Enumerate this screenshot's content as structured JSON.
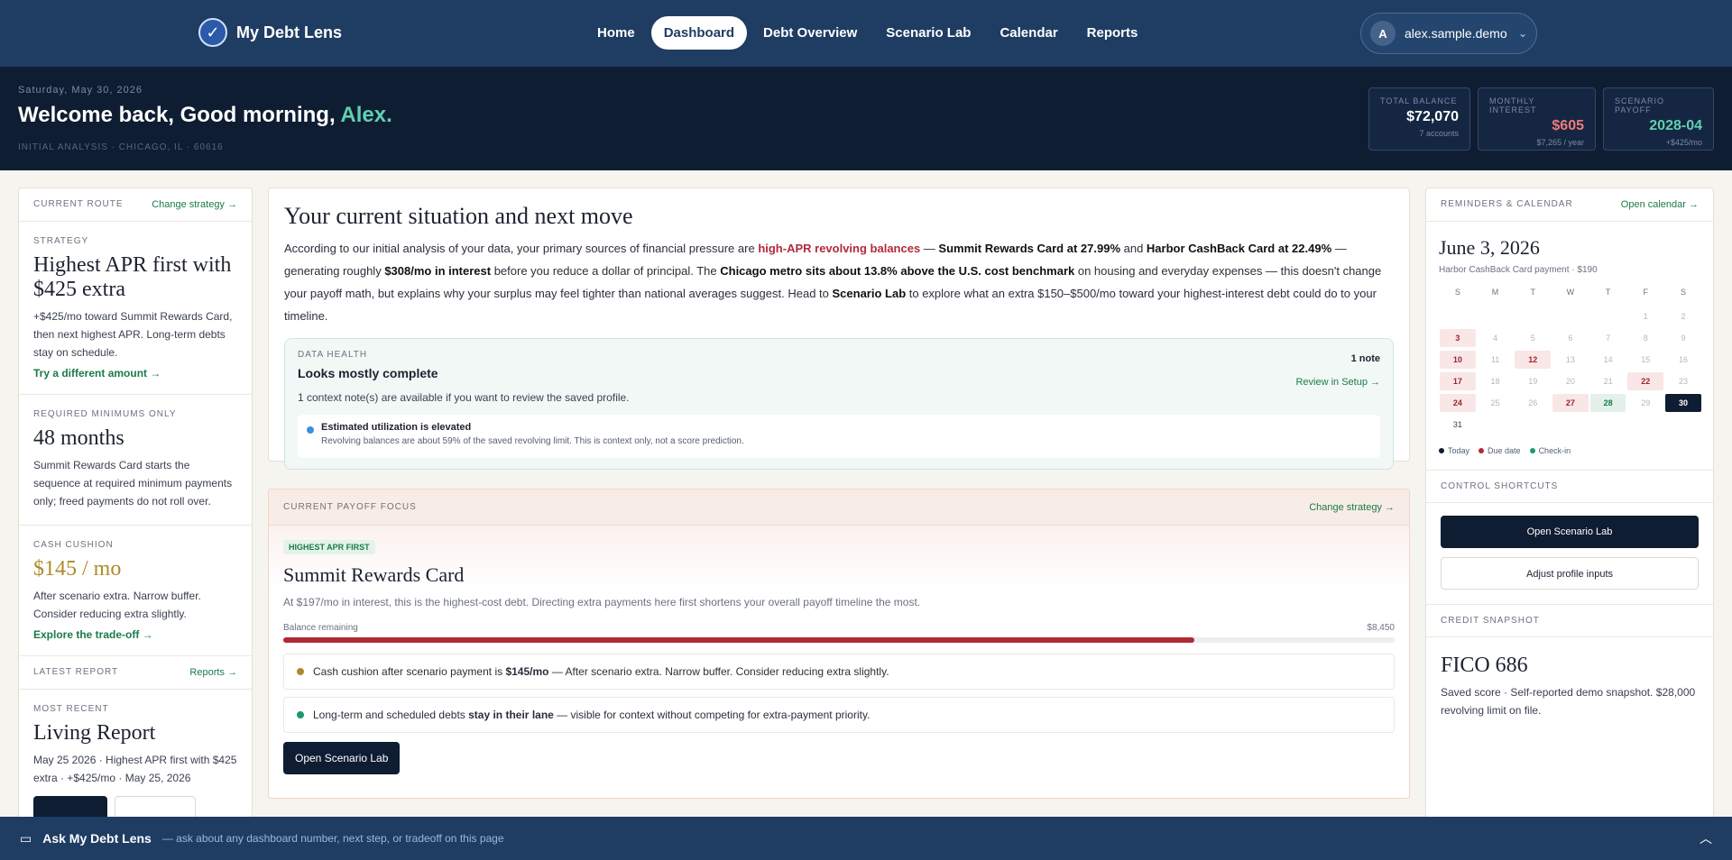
{
  "app": {
    "name": "My Debt Lens"
  },
  "nav": {
    "links": [
      "Home",
      "Dashboard",
      "Debt Overview",
      "Scenario Lab",
      "Calendar",
      "Reports"
    ],
    "active": "Dashboard"
  },
  "user": {
    "initial": "A",
    "name": "alex.sample.demo"
  },
  "hero": {
    "date": "Saturday, May 30, 2026",
    "greeting": "Welcome back, Good morning, ",
    "name": "Alex.",
    "subtitle": "INITIAL ANALYSIS · CHICAGO, IL · 60616"
  },
  "stats": [
    {
      "label": "TOTAL BALANCE",
      "value": "$72,070",
      "note": "7 accounts",
      "color": "#ffffff"
    },
    {
      "label": "MONTHLY INTEREST",
      "value": "$605",
      "note": "$7,265 / year",
      "color": "#f07a7a"
    },
    {
      "label": "SCENARIO PAYOFF",
      "value": "2028-04",
      "note": "+$425/mo",
      "color": "#5fd0b0"
    }
  ],
  "left": {
    "route": {
      "label": "CURRENT ROUTE",
      "link": "Change strategy →"
    },
    "strategy": {
      "kicker": "STRATEGY",
      "title": "Highest APR first with $425 extra",
      "text": "+$425/mo toward Summit Rewards Card, then next highest APR. Long-term debts stay on schedule.",
      "action": "Try a different amount →"
    },
    "minimums": {
      "kicker": "REQUIRED MINIMUMS ONLY",
      "title": "48 months",
      "text": "Summit Rewards Card starts the sequence at required minimum payments only; freed payments do not roll over."
    },
    "cushion": {
      "kicker": "CASH CUSHION",
      "title": "$145 / mo",
      "text": "After scenario extra. Narrow buffer. Consider reducing extra slightly.",
      "action": "Explore the trade-off →"
    },
    "report": {
      "label": "LATEST REPORT",
      "link": "Reports →",
      "kicker": "MOST RECENT",
      "title": "Living Report",
      "text": "May 25 2026 · Highest APR first with $425 extra · +$425/mo · May 25, 2026"
    }
  },
  "situation": {
    "title": "Your current situation and next move",
    "p1": "According to our initial analysis of your data, your primary sources of financial pressure are ",
    "p2": "high-APR revolving balances",
    "p3": " — ",
    "p4": "Summit Rewards Card at 27.99%",
    "p5": " and ",
    "p6": "Harbor CashBack Card at 22.49%",
    "p7": " — generating roughly ",
    "p8": "$308/mo in interest",
    "p9": " before you reduce a dollar of principal. The ",
    "p10": "Chicago metro sits about 13.8% above the U.S. cost benchmark",
    "p11": " on housing and everyday expenses — this doesn't change your payoff math, but explains why your surplus may feel tighter than national averages suggest. Head to ",
    "p12": "Scenario Lab",
    "p13": " to explore what an extra $150–$500/mo toward your highest-interest debt could do to your timeline.",
    "health": {
      "kicker": "DATA HEALTH",
      "title": "Looks mostly complete",
      "note": "1 note",
      "review": "Review in Setup →",
      "sub": "1 context note(s) are available if you want to review the saved profile.",
      "est_title": "Estimated utilization is elevated",
      "est_text": "Revolving balances are about 59% of the saved revolving limit. This is context only, not a score prediction."
    }
  },
  "focus": {
    "kicker": "CURRENT PAYOFF FOCUS",
    "link": "Change strategy →",
    "pill": "HIGHEST APR FIRST",
    "title": "Summit Rewards Card",
    "desc": "At $197/mo in interest, this is the highest-cost debt. Directing extra payments here first shortens your overall payoff timeline the most.",
    "bal_label": "Balance remaining",
    "bal_value": "$8,450",
    "progress": 0.82,
    "b1a": "Cash cushion after scenario payment is ",
    "b1b": "$145/mo",
    "b1c": " — After scenario extra. Narrow buffer. Consider reducing extra slightly.",
    "b2a": "Long-term and scheduled debts ",
    "b2b": "stay in their lane",
    "b2c": " — visible for context without competing for extra-payment priority.",
    "button": "Open Scenario Lab"
  },
  "calendar": {
    "label": "REMINDERS & CALENDAR",
    "link": "Open calendar →",
    "date": "June 3, 2026",
    "sub": "Harbor CashBack Card payment · $190",
    "weekdays": [
      "S",
      "M",
      "T",
      "W",
      "T",
      "F",
      "S"
    ],
    "days": [
      {
        "d": "",
        "t": ""
      },
      {
        "d": "",
        "t": ""
      },
      {
        "d": "",
        "t": ""
      },
      {
        "d": "",
        "t": ""
      },
      {
        "d": "",
        "t": ""
      },
      {
        "d": "1",
        "t": ""
      },
      {
        "d": "2",
        "t": ""
      },
      {
        "d": "3",
        "t": "due"
      },
      {
        "d": "4",
        "t": ""
      },
      {
        "d": "5",
        "t": ""
      },
      {
        "d": "6",
        "t": ""
      },
      {
        "d": "7",
        "t": ""
      },
      {
        "d": "8",
        "t": ""
      },
      {
        "d": "9",
        "t": ""
      },
      {
        "d": "10",
        "t": "due"
      },
      {
        "d": "11",
        "t": ""
      },
      {
        "d": "12",
        "t": "due"
      },
      {
        "d": "13",
        "t": ""
      },
      {
        "d": "14",
        "t": ""
      },
      {
        "d": "15",
        "t": ""
      },
      {
        "d": "16",
        "t": ""
      },
      {
        "d": "17",
        "t": "due"
      },
      {
        "d": "18",
        "t": ""
      },
      {
        "d": "19",
        "t": ""
      },
      {
        "d": "20",
        "t": ""
      },
      {
        "d": "21",
        "t": ""
      },
      {
        "d": "22",
        "t": "due"
      },
      {
        "d": "23",
        "t": ""
      },
      {
        "d": "24",
        "t": "due"
      },
      {
        "d": "25",
        "t": ""
      },
      {
        "d": "26",
        "t": ""
      },
      {
        "d": "27",
        "t": "due"
      },
      {
        "d": "28",
        "t": "chk"
      },
      {
        "d": "29",
        "t": ""
      },
      {
        "d": "30",
        "t": "today"
      },
      {
        "d": "31",
        "t": "plain"
      }
    ],
    "legend": [
      "Today",
      "Due date",
      "Check-in"
    ]
  },
  "shortcuts": {
    "label": "CONTROL SHORTCUTS",
    "primary": "Open Scenario Lab",
    "secondary": "Adjust profile inputs"
  },
  "credit": {
    "label": "CREDIT SNAPSHOT",
    "score": "FICO 686",
    "text": "Saved score · Self-reported demo snapshot. $28,000 revolving limit on file."
  },
  "ask": {
    "title": "Ask My Debt Lens",
    "sub": "— ask about any dashboard number, next step, or tradeoff on this page"
  }
}
